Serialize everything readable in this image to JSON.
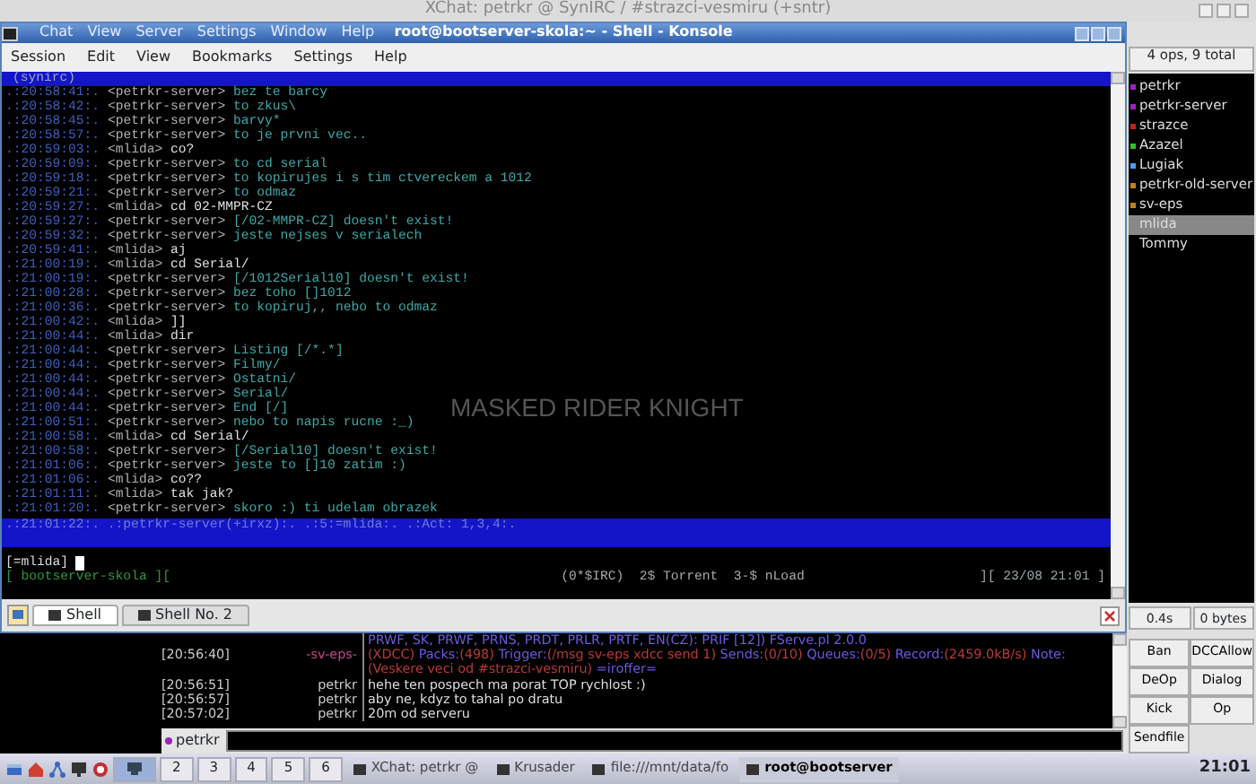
{
  "xchat_window": {
    "title": "XChat: petrkr @ SynIRC / #strazci-vesmiru (+sntr)",
    "menu": [
      "Chat",
      "View",
      "Server",
      "Settings",
      "Window",
      "Help"
    ]
  },
  "konsole": {
    "title": "root@bootserver-skola:~ - Shell - Konsole",
    "menu": [
      "Session",
      "Edit",
      "View",
      "Bookmarks",
      "Settings",
      "Help"
    ],
    "terminal": {
      "header": "(synirc)",
      "wallpaper_text": "MASKED RIDER KNIGHT",
      "lines": [
        {
          "time": ".:20:58:41:.",
          "nick": "<petrkr-server>",
          "text": "bez te barcy",
          "own": false
        },
        {
          "time": ".:20:58:42:.",
          "nick": "<petrkr-server>",
          "text": "to zkus\\",
          "own": false
        },
        {
          "time": ".:20:58:45:.",
          "nick": "<petrkr-server>",
          "text": "barvy*",
          "own": false
        },
        {
          "time": ".:20:58:57:.",
          "nick": "<petrkr-server>",
          "text": "to je prvni vec..",
          "own": false
        },
        {
          "time": ".:20:59:03:.",
          "nick": "<mlida>",
          "text": "co?",
          "own": true
        },
        {
          "time": ".:20:59:09:.",
          "nick": "<petrkr-server>",
          "text": "to cd serial",
          "own": false
        },
        {
          "time": ".:20:59:18:.",
          "nick": "<petrkr-server>",
          "text": "to kopirujes i s tim ctvereckem a 1012",
          "own": false
        },
        {
          "time": ".:20:59:21:.",
          "nick": "<petrkr-server>",
          "text": "to odmaz",
          "own": false
        },
        {
          "time": ".:20:59:27:.",
          "nick": "<mlida>",
          "text": "cd 02-MMPR-CZ",
          "own": true
        },
        {
          "time": ".:20:59:27:.",
          "nick": "<petrkr-server>",
          "text": "[/02-MMPR-CZ] doesn't exist!",
          "own": false
        },
        {
          "time": ".:20:59:32:.",
          "nick": "<petrkr-server>",
          "text": "jeste nejses v serialech",
          "own": false
        },
        {
          "time": ".:20:59:41:.",
          "nick": "<mlida>",
          "text": "aj",
          "own": true
        },
        {
          "time": ".:21:00:19:.",
          "nick": "<mlida>",
          "text": "cd Serial/",
          "own": true
        },
        {
          "time": ".:21:00:19:.",
          "nick": "<petrkr-server>",
          "text": "[/1012Serial10] doesn't exist!",
          "own": false
        },
        {
          "time": ".:21:00:28:.",
          "nick": "<petrkr-server>",
          "text": "bez toho []1012",
          "own": false
        },
        {
          "time": ".:21:00:36:.",
          "nick": "<petrkr-server>",
          "text": "to kopiruj,, nebo to odmaz",
          "own": false
        },
        {
          "time": ".:21:00:42:.",
          "nick": "<mlida>",
          "text": "]]",
          "own": true
        },
        {
          "time": ".:21:00:44:.",
          "nick": "<mlida>",
          "text": "dir",
          "own": true
        },
        {
          "time": ".:21:00:44:.",
          "nick": "<petrkr-server>",
          "text": "Listing [/*.*]",
          "own": false
        },
        {
          "time": ".:21:00:44:.",
          "nick": "<petrkr-server>",
          "text": "Filmy/",
          "own": false
        },
        {
          "time": ".:21:00:44:.",
          "nick": "<petrkr-server>",
          "text": "Ostatni/",
          "own": false
        },
        {
          "time": ".:21:00:44:.",
          "nick": "<petrkr-server>",
          "text": "Serial/",
          "own": false
        },
        {
          "time": ".:21:00:44:.",
          "nick": "<petrkr-server>",
          "text": "End [/]",
          "own": false
        },
        {
          "time": ".:21:00:51:.",
          "nick": "<petrkr-server>",
          "text": "nebo to napis rucne :_)",
          "own": false
        },
        {
          "time": ".:21:00:58:.",
          "nick": "<mlida>",
          "text": "cd Serial/",
          "own": true
        },
        {
          "time": ".:21:00:58:.",
          "nick": "<petrkr-server>",
          "text": "[/Serial10] doesn't exist!",
          "own": false
        },
        {
          "time": ".:21:01:06:.",
          "nick": "<petrkr-server>",
          "text": "jeste to []10 zatim :)",
          "own": false
        },
        {
          "time": ".:21:01:06:.",
          "nick": "<mlida>",
          "text": "co??",
          "own": true
        },
        {
          "time": ".:21:01:11:.",
          "nick": "<mlida>",
          "text": "tak jak?",
          "own": true
        },
        {
          "time": ".:21:01:20:.",
          "nick": "<petrkr-server>",
          "text": "skoro :) ti udelam obrazek",
          "own": false
        }
      ],
      "status_line": ".:21:01:22:. .:petrkr-server(+irxz):. .:5:=mlida:. .:Act: 1,3,4:.",
      "prompt": "[=mlida]",
      "bottom_left": "[ bootserver-skola ][",
      "bottom_middle": "(0*$IRC)  2$ Torrent  3-$ nLoad",
      "bottom_right": "][ 23/08 21:01 ]"
    },
    "tabs": [
      {
        "label": "Shell",
        "selected": true
      },
      {
        "label": "Shell No. 2",
        "selected": false
      }
    ]
  },
  "chat": {
    "lines": [
      {
        "parts": [
          {
            "text": "PRWF, SK, PRWF, PRNS, PRDT, PRLR, PRTF, EN(CZ): PRIF [12]) FServe.pl 2.0.0",
            "kind": "key"
          }
        ]
      },
      {
        "time": "[20:56:40]",
        "nick": "-sv-eps-",
        "parts": [
          {
            "text": "(XDCC) ",
            "kind": "value"
          },
          {
            "text": "Packs:",
            "kind": "key"
          },
          {
            "text": "(498) ",
            "kind": "value"
          },
          {
            "text": "Trigger:",
            "kind": "key"
          },
          {
            "text": "(/msg sv-eps xdcc send 1) ",
            "kind": "value"
          },
          {
            "text": "Sends:",
            "kind": "key"
          },
          {
            "text": "(0/10) ",
            "kind": "value"
          },
          {
            "text": "Queues:",
            "kind": "key"
          },
          {
            "text": "(0/5) ",
            "kind": "value"
          },
          {
            "text": "Record:",
            "kind": "key"
          },
          {
            "text": "(2459.0kB/s) ",
            "kind": "value"
          },
          {
            "text": "Note:",
            "kind": "key"
          },
          {
            "text": "(Veskere veci od #strazci-vesmiru) ",
            "kind": "value"
          },
          {
            "text": "=iroffer=",
            "kind": "key"
          }
        ]
      },
      {
        "time": "[20:56:51]",
        "nick": "petrkr",
        "parts": [
          {
            "text": "hehe ten pospech ma porat TOP rychlost :)",
            "kind": "plain"
          }
        ]
      },
      {
        "time": "[20:56:57]",
        "nick": "petrkr",
        "parts": [
          {
            "text": "aby ne, kdyz to tahal po dratu",
            "kind": "plain"
          }
        ]
      },
      {
        "time": "[20:57:02]",
        "nick": "petrkr",
        "parts": [
          {
            "text": "20m od serveru",
            "kind": "plain"
          }
        ]
      }
    ],
    "input_nick": "petrkr"
  },
  "userlist": {
    "summary": "4 ops, 9 total",
    "users": [
      {
        "name": "petrkr",
        "color": "#a020c0",
        "selected": false
      },
      {
        "name": "petrkr-server",
        "color": "#a020c0",
        "selected": false
      },
      {
        "name": "strazce",
        "color": "#c02020",
        "selected": false
      },
      {
        "name": "Azazel",
        "color": "#30c030",
        "selected": false
      },
      {
        "name": "Lugiak",
        "color": "#40a0ff",
        "selected": false
      },
      {
        "name": "petrkr-old-server",
        "color": "#c08020",
        "selected": false
      },
      {
        "name": "sv-eps",
        "color": "#c08020",
        "selected": false
      },
      {
        "name": "mlida",
        "selected": true
      },
      {
        "name": "Tommy",
        "selected": false
      }
    ],
    "lag": "0.4s",
    "throughput": "0 bytes",
    "buttons": [
      "Ban",
      "DCCAllow",
      "DeOp",
      "Dialog",
      "Kick",
      "Op",
      "Sendfile"
    ]
  },
  "taskbar": {
    "desktops": [
      {
        "kind": "icon",
        "selected": true
      },
      {
        "kind": "number",
        "label": "2",
        "selected": false
      },
      {
        "kind": "number",
        "label": "3",
        "selected": false
      },
      {
        "kind": "number",
        "label": "4",
        "selected": false
      },
      {
        "kind": "number",
        "label": "5",
        "selected": false
      },
      {
        "kind": "number",
        "label": "6",
        "selected": false
      }
    ],
    "tasks": [
      {
        "label": "XChat: petrkr @",
        "selected": false
      },
      {
        "label": "Krusader",
        "selected": false
      },
      {
        "label": "file:///mnt/data/fo",
        "selected": false
      },
      {
        "label": "root@bootserver",
        "selected": true
      }
    ],
    "clock": "21:01"
  }
}
